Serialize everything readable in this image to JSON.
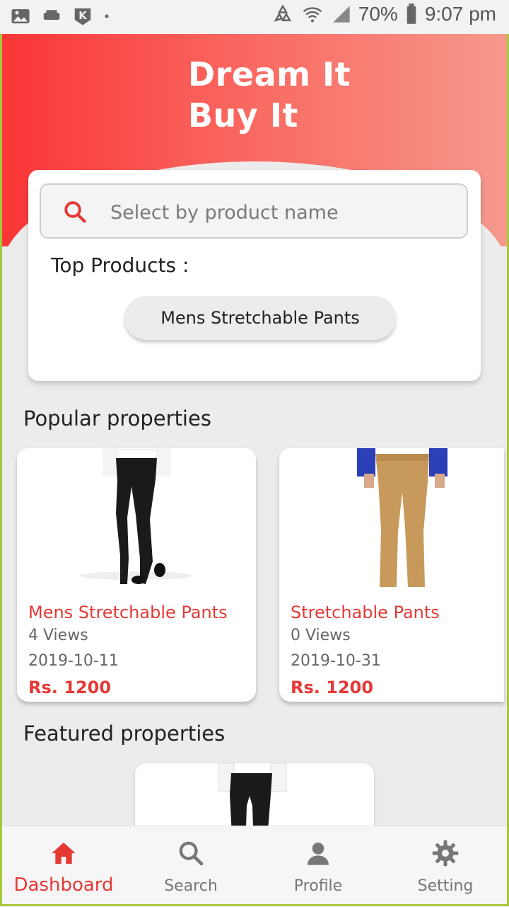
{
  "status_bar": {
    "battery": "70%",
    "time": "9:07 pm",
    "icons": [
      "image-icon",
      "cast-icon",
      "k-app-icon",
      "dot-icon",
      "recycle-icon",
      "wifi-icon",
      "signal-icon",
      "battery-icon"
    ]
  },
  "header": {
    "title_line1": "Dream It",
    "title_line2": "Buy It",
    "gradient": [
      "#fa3536",
      "#f6998d"
    ]
  },
  "search": {
    "placeholder": "Select by product name",
    "top_products_label": "Top Products :",
    "top_product_chip": "Mens Stretchable Pants"
  },
  "popular": {
    "title": "Popular properties",
    "items": [
      {
        "name": "Mens Stretchable Pants",
        "views": "4 Views",
        "date": "2019-10-11",
        "price": "Rs. 1200"
      },
      {
        "name": "Stretchable Pants",
        "views": "0 Views",
        "date": "2019-10-31",
        "price": "Rs. 1200"
      }
    ]
  },
  "featured": {
    "title": "Featured properties"
  },
  "bottom_nav": {
    "items": [
      {
        "label": "Dashboard",
        "icon": "home-icon",
        "active": true
      },
      {
        "label": "Search",
        "icon": "search-icon",
        "active": false
      },
      {
        "label": "Profile",
        "icon": "person-icon",
        "active": false
      },
      {
        "label": "Setting",
        "icon": "gear-icon",
        "active": false
      }
    ]
  },
  "colors": {
    "accent": "#e53935",
    "background": "#ececec"
  }
}
